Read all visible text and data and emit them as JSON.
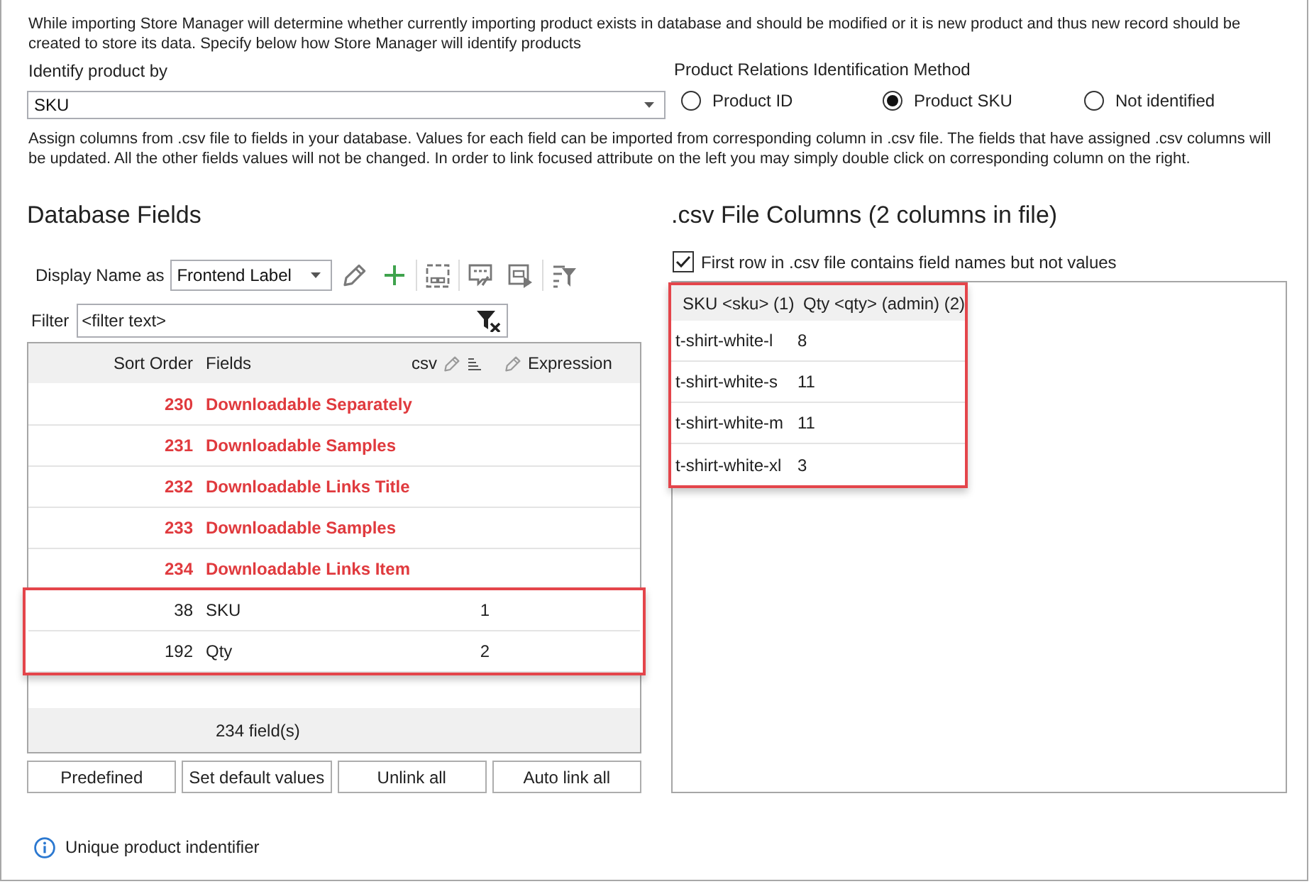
{
  "intro": "While importing Store Manager will determine whether currently importing product exists in database and should be modified or it is new product and thus new record should be created to store its data. Specify below how Store Manager will identify products",
  "identify_product": {
    "label": "Identify product by",
    "value": "SKU"
  },
  "relations_method": {
    "title": "Product Relations Identification Method",
    "options": [
      {
        "label": "Product ID",
        "selected": false
      },
      {
        "label": "Product SKU",
        "selected": true
      },
      {
        "label": "Not identified",
        "selected": false
      }
    ]
  },
  "assign_note": "Assign columns from .csv file to fields in your database. Values for each field can be imported from corresponding column in .csv file. The fields that have assigned .csv columns will be updated. All the other fields values will not be changed. In order to link focused attribute on the left you may simply double click on corresponding column on the right.",
  "database_fields": {
    "title": "Database Fields",
    "display_name": {
      "label": "Display Name as",
      "value": "Frontend Label"
    },
    "filter": {
      "label": "Filter",
      "placeholder": "<filter text>"
    },
    "columns": [
      "Sort Order",
      "Fields",
      "csv",
      "Expression"
    ],
    "rows": [
      {
        "sort_order": "230",
        "field": "Downloadable Separately",
        "warning": true,
        "highlighted": false
      },
      {
        "sort_order": "231",
        "field": "Downloadable Samples",
        "warning": true,
        "highlighted": false
      },
      {
        "sort_order": "232",
        "field": "Downloadable Links Title",
        "warning": true,
        "highlighted": false
      },
      {
        "sort_order": "233",
        "field": "Downloadable Samples",
        "warning": true,
        "highlighted": false
      },
      {
        "sort_order": "234",
        "field": "Downloadable Links Item",
        "warning": true,
        "highlighted": false
      },
      {
        "sort_order": "38",
        "field": "SKU",
        "csv": "1",
        "warning": false,
        "highlighted": true
      },
      {
        "sort_order": "192",
        "field": "Qty",
        "csv": "2",
        "warning": false,
        "highlighted": true
      }
    ],
    "footer": "234 field(s)",
    "buttons": [
      "Predefined",
      "Set default values",
      "Unlink all",
      "Auto link all"
    ]
  },
  "csv_columns": {
    "title": ".csv File Columns (2 columns in file)",
    "first_row_names": {
      "label": "First row in .csv file contains field names but not values",
      "checked": true
    },
    "highlighted": true,
    "columns": [
      "SKU <sku> (1)",
      "Qty <qty> (admin) (2)"
    ],
    "rows": [
      [
        "t-shirt-white-l",
        "8"
      ],
      [
        "t-shirt-white-s",
        "11"
      ],
      [
        "t-shirt-white-m",
        "11"
      ],
      [
        "t-shirt-white-xl",
        "3"
      ]
    ]
  },
  "note": "Unique product indentifier"
}
